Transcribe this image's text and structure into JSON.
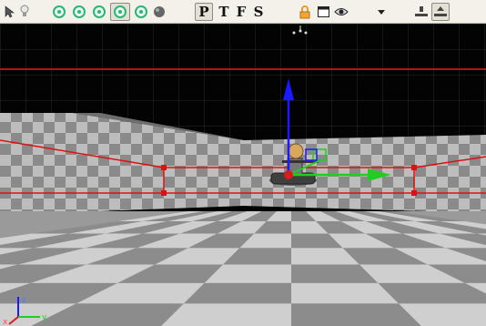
{
  "toolbar": {
    "view_buttons": [
      "P",
      "T",
      "F",
      "S"
    ],
    "active_view": "P"
  },
  "viewport": {
    "axis_labels": {
      "x": "x",
      "y": "y",
      "z": "z"
    },
    "colors": {
      "x_axis": "#22cc22",
      "z_axis": "#1a1aff",
      "selection": "#dd1a1a",
      "floor_light": "#cfcfcf",
      "floor_dark": "#8c8c8c"
    }
  }
}
